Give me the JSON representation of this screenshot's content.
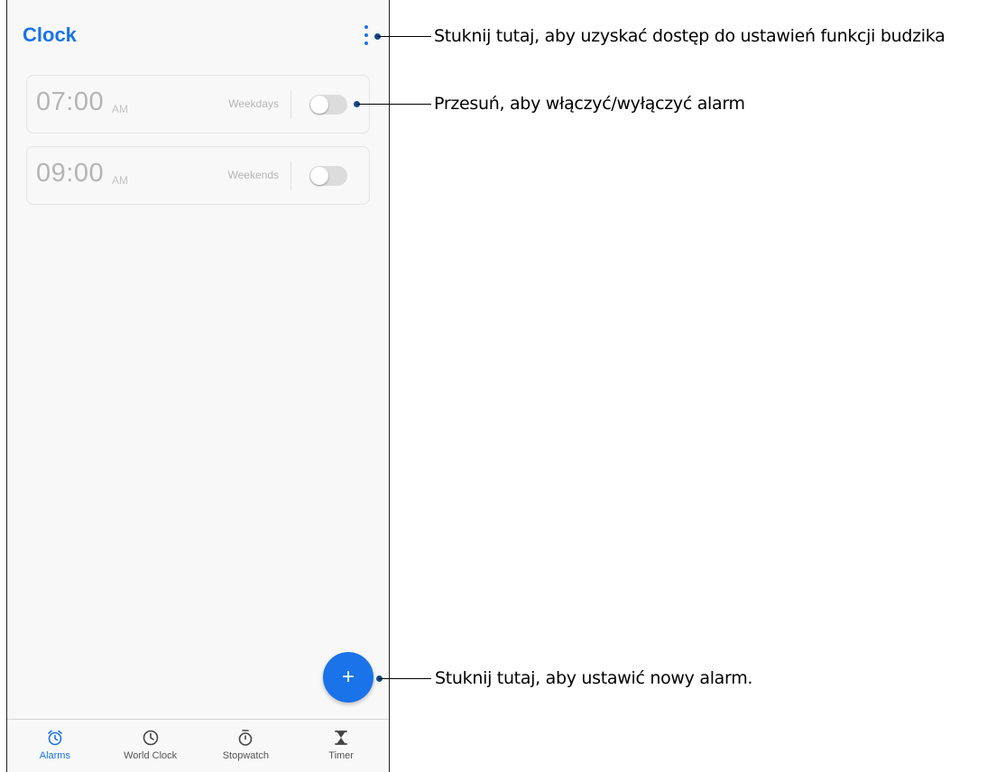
{
  "app": {
    "title": "Clock"
  },
  "alarms": [
    {
      "time": "07:00",
      "ampm": "AM",
      "repeat": "Weekdays",
      "enabled": false
    },
    {
      "time": "09:00",
      "ampm": "AM",
      "repeat": "Weekends",
      "enabled": false
    }
  ],
  "fab": {
    "label": "+"
  },
  "nav": [
    {
      "label": "Alarms",
      "icon": "alarm-icon",
      "active": true
    },
    {
      "label": "World Clock",
      "icon": "clock-icon",
      "active": false
    },
    {
      "label": "Stopwatch",
      "icon": "stopwatch-icon",
      "active": false
    },
    {
      "label": "Timer",
      "icon": "hourglass-icon",
      "active": false
    }
  ],
  "annotations": {
    "settings": "Stuknij tutaj, aby uzyskać dostęp do ustawień funkcji budzika",
    "toggle": "Przesuń, aby włączyć/wyłączyć alarm",
    "add": "Stuknij tutaj, aby ustawić nowy alarm."
  },
  "colors": {
    "accent": "#1a73e8",
    "callout_dot": "#0c4a8c"
  }
}
